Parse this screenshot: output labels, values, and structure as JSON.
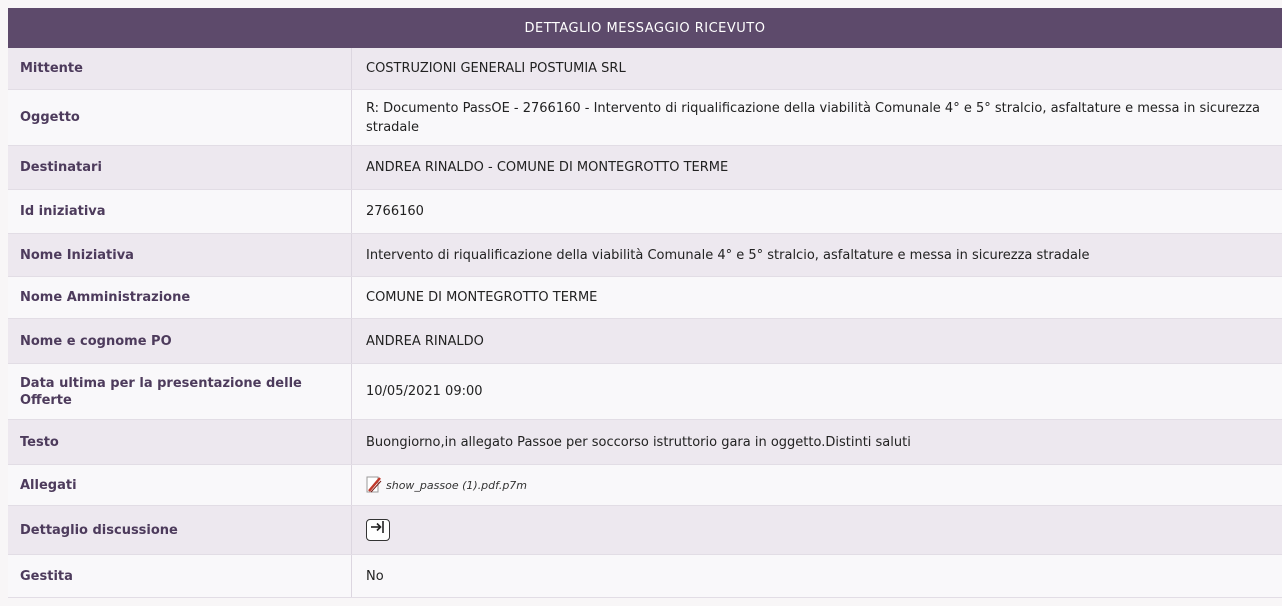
{
  "header": {
    "title": "DETTAGLIO MESSAGGIO RICEVUTO"
  },
  "rows": [
    {
      "label": "Mittente",
      "value": "COSTRUZIONI GENERALI POSTUMIA SRL"
    },
    {
      "label": "Oggetto",
      "value": "R: Documento PassOE - 2766160 - Intervento di riqualificazione della viabilità Comunale 4° e 5° stralcio, asfaltature e messa in sicurezza stradale"
    },
    {
      "label": "Destinatari",
      "value": "ANDREA RINALDO - COMUNE DI MONTEGROTTO TERME"
    },
    {
      "label": "Id iniziativa",
      "value": "2766160"
    },
    {
      "label": "Nome Iniziativa",
      "value": "Intervento di riqualificazione della viabilità Comunale 4° e 5° stralcio, asfaltature e messa in sicurezza stradale"
    },
    {
      "label": "Nome Amministrazione",
      "value": "COMUNE DI MONTEGROTTO TERME"
    },
    {
      "label": "Nome e cognome PO",
      "value": "ANDREA RINALDO"
    },
    {
      "label": "Data ultima per la presentazione delle Offerte",
      "value": "10/05/2021 09:00"
    },
    {
      "label": "Testo",
      "value": "Buongiorno,in allegato Passoe per soccorso istruttorio gara in oggetto.Distinti saluti"
    },
    {
      "label": "Allegati",
      "value": "show_passoe (1).pdf.p7m",
      "icon": "signed-file-icon"
    },
    {
      "label": "Dettaglio discussione",
      "icon": "enter-arrow-icon"
    },
    {
      "label": "Gestita",
      "value": "No"
    }
  ]
}
